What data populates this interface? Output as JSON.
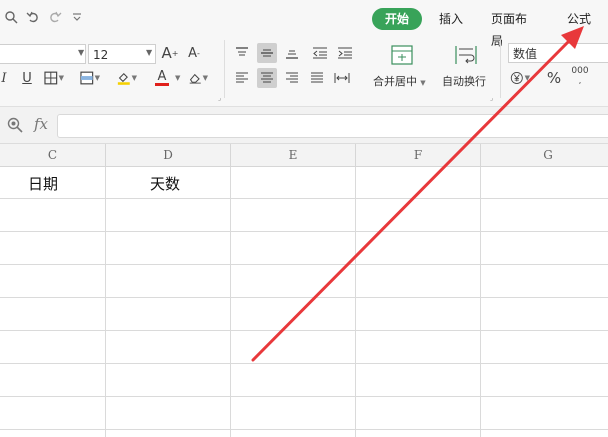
{
  "quick_access": {
    "icons": [
      "print-preview-icon",
      "undo-icon",
      "redo-icon",
      "customize-icon"
    ]
  },
  "tabs": [
    {
      "label": "开始",
      "active": true
    },
    {
      "label": "插入",
      "active": false
    },
    {
      "label": "页面布局",
      "active": false
    },
    {
      "label": "公式",
      "active": false
    }
  ],
  "font": {
    "name_value": "",
    "size_value": "12",
    "grow_label": "A",
    "shrink_label": "A",
    "italic_label": "I",
    "underline_label": "U",
    "font_color_label": "A"
  },
  "alignment": {
    "merge_label": "合并居中",
    "wrap_label": "自动换行"
  },
  "number": {
    "format_value": "数值",
    "percent_label": "%",
    "thousands_label": "000"
  },
  "formula_bar": {
    "fx_label": "fx",
    "value": ""
  },
  "columns": [
    "C",
    "D",
    "E",
    "F",
    "G"
  ],
  "cells": {
    "c1": "日期",
    "d1": "天数"
  },
  "colors": {
    "active_tab": "#38a359",
    "fill_color": "#f5d000",
    "font_color": "#e0201b",
    "arrow": "#e8383b"
  }
}
